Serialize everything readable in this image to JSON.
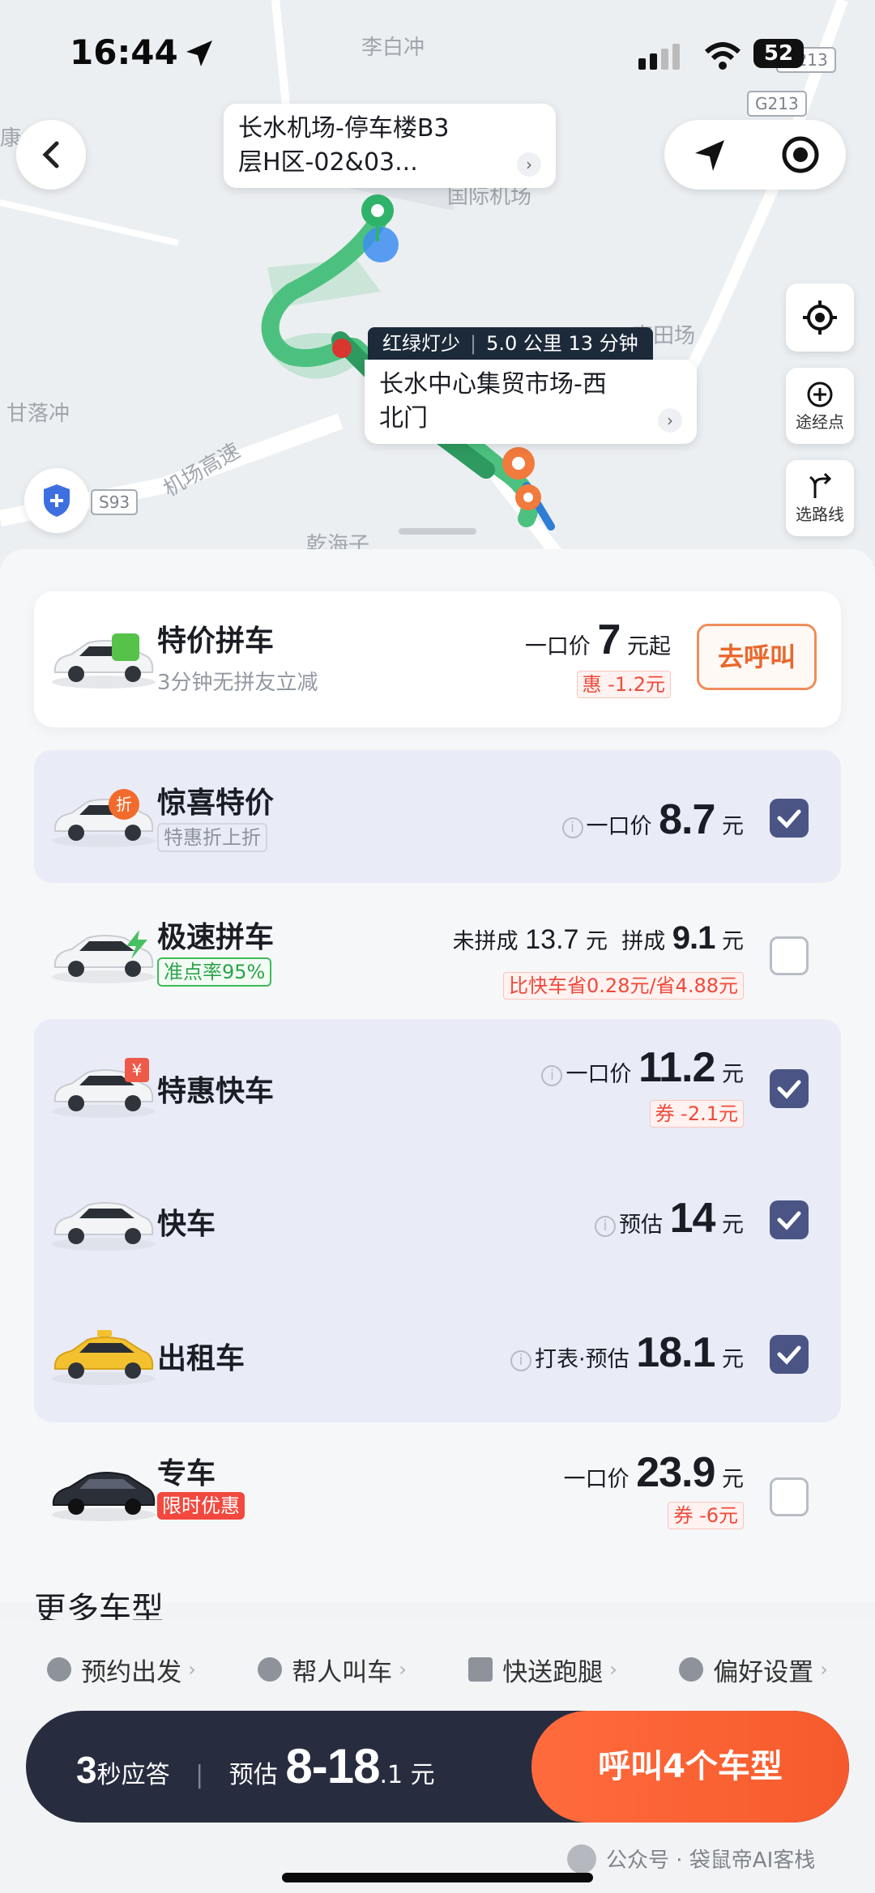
{
  "status_bar": {
    "time": "16:44",
    "battery": "52"
  },
  "map": {
    "labels": [
      "李白冲",
      "甘落冲",
      "机场高速",
      "乾海子",
      "国际机场",
      "高田场",
      "康"
    ],
    "road_tags": [
      "G213",
      "G213",
      "S93"
    ],
    "pickup": "长水机场-停车楼B3层H区-02&03...",
    "pickup_line1": "长水机场-停车楼B3",
    "pickup_line2": "层H区-02&03...",
    "route_info": {
      "lights": "红绿灯少",
      "distance_time": "5.0 公里 13 分钟"
    },
    "dropoff_line1": "长水中心集贸市场-西",
    "dropoff_line2": "北门",
    "waypoint_label": "途经点",
    "route_select_label": "选路线"
  },
  "featured": {
    "title": "特价拼车",
    "subtitle": "3分钟无拼友立减",
    "price_prefix": "一口价",
    "price": "7",
    "price_suffix": "元起",
    "discount": "惠 -1.2元",
    "button": "去呼叫"
  },
  "rides": [
    {
      "title": "惊喜特价",
      "tag": "特惠折上折",
      "price_prefix": "一口价",
      "price": "8.7",
      "unit": "元",
      "checked": true,
      "car_badge": "折"
    },
    {
      "title": "极速拼车",
      "tag": "准点率95%",
      "unmatched_label": "未拼成",
      "unmatched_price": "13.7",
      "matched_label": "拼成",
      "price": "9.1",
      "unit": "元",
      "discount": "比快车省0.28元/省4.88元",
      "checked": false
    },
    {
      "title": "特惠快车",
      "price_prefix": "一口价",
      "price": "11.2",
      "unit": "元",
      "discount": "券 -2.1元",
      "checked": true,
      "car_badge": "¥"
    },
    {
      "title": "快车",
      "price_prefix": "预估",
      "price": "14",
      "unit": "元",
      "checked": true
    },
    {
      "title": "出租车",
      "price_prefix": "打表·预估",
      "price": "18.1",
      "unit": "元",
      "checked": true
    },
    {
      "title": "专车",
      "tag": "限时优惠",
      "price_prefix": "一口价",
      "price": "23.9",
      "unit": "元",
      "discount": "券 -6元",
      "checked": false
    }
  ],
  "more_label": "更多车型",
  "shortcuts": [
    "预约出发",
    "帮人叫车",
    "快送跑腿",
    "偏好设置"
  ],
  "bottom_bar": {
    "response_num": "3",
    "response_text": "秒应答",
    "estimate_label": "预估",
    "estimate_range": "8-18",
    "estimate_decimal": ".1",
    "estimate_unit": "元",
    "cta": "呼叫4个车型"
  },
  "watermark": "公众号 · 袋鼠帝AI客栈",
  "colors": {
    "accent": "#f65a2c",
    "check": "#4a5585",
    "dark": "#272c3f",
    "route": "#3dbb6e"
  }
}
